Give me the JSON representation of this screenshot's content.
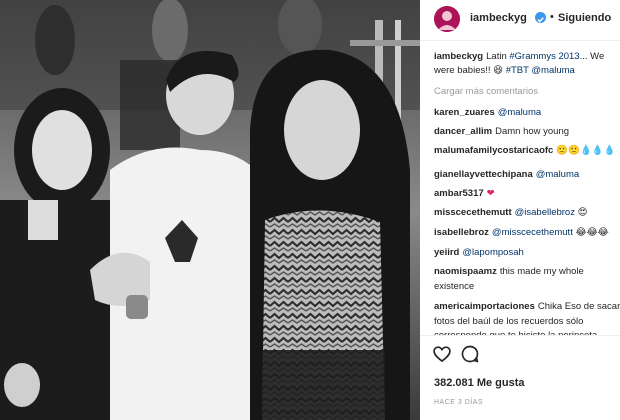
{
  "post": {
    "username": "iambeckyg",
    "follow_label": "Siguiendo",
    "separator": "•",
    "caption": {
      "username": "iambeckyg",
      "line1_text": "Latin ",
      "line1_tag": "#Grammys 2013",
      "line1_tail": "... We",
      "line2_text": "were babies!! 😆 ",
      "line2_tag1": "#TBT",
      "line2_tag2": "@maluma"
    },
    "load_more": "Cargar más comentarios",
    "comments": [
      {
        "user": "karen_zuares",
        "text": "",
        "tag": "@maluma"
      },
      {
        "user": "dancer_allim",
        "text": "Damn how young",
        "tag": ""
      },
      {
        "user": "malumafamilycostaricaofc",
        "text": "🙁🙁💧💧💧",
        "tag": ""
      },
      {
        "user": "gianellayvettechipana",
        "text": "",
        "tag": "@maluma"
      },
      {
        "user": "ambar5317",
        "text": "❤",
        "tag": ""
      },
      {
        "user": "misscecethemutt",
        "text": "😍",
        "tag": "@isabellebroz"
      },
      {
        "user": "isabellebroz",
        "text": "😂😂😂",
        "tag": "@misscecethemutt"
      },
      {
        "user": "yeiird",
        "text": "",
        "tag": "@lapomposah"
      },
      {
        "user": "naomispaamz",
        "text": "this made my whole",
        "tag": ""
      },
      {
        "user": "",
        "text": "existence",
        "tag": ""
      },
      {
        "user": "americaimportaciones",
        "text": "Chika Eso de sacar",
        "tag": ""
      },
      {
        "user": "",
        "text": "fotos del baúl de los recuerdos sólo",
        "tag": ""
      },
      {
        "user": "",
        "text": "corresponde que te hiciste la perinceta",
        "tag": ""
      }
    ],
    "likes": "382.081 Me gusta",
    "time": "HACE 3 DÍAS",
    "icons": {
      "like": "heart-icon",
      "comment": "comment-icon",
      "verified": "verified-badge-icon"
    },
    "colors": {
      "link": "#003569",
      "muted": "#999999",
      "verified": "#3897f0"
    }
  }
}
